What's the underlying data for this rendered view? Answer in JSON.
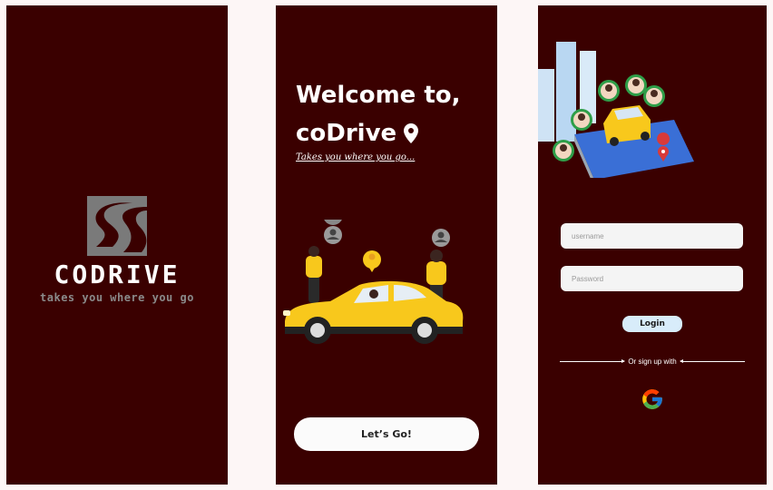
{
  "splash": {
    "brand_name": "CODRIVE",
    "tagline": "takes you where you go"
  },
  "welcome": {
    "heading_line1": "Welcome to,",
    "heading_line2": "coDrive",
    "subtitle": "Takes you where you go...",
    "cta_label": "Let’s Go!"
  },
  "login": {
    "username_placeholder": "username",
    "password_placeholder": "Password",
    "login_label": "Login",
    "divider_text": "Or sign up with",
    "social_icon": "google-icon"
  },
  "colors": {
    "screen_background": "#3a0000",
    "page_background": "#fdf6f6",
    "accent_yellow": "#f8c81c",
    "button_light": "#fbfbfb",
    "login_button": "#d8ecfa"
  }
}
